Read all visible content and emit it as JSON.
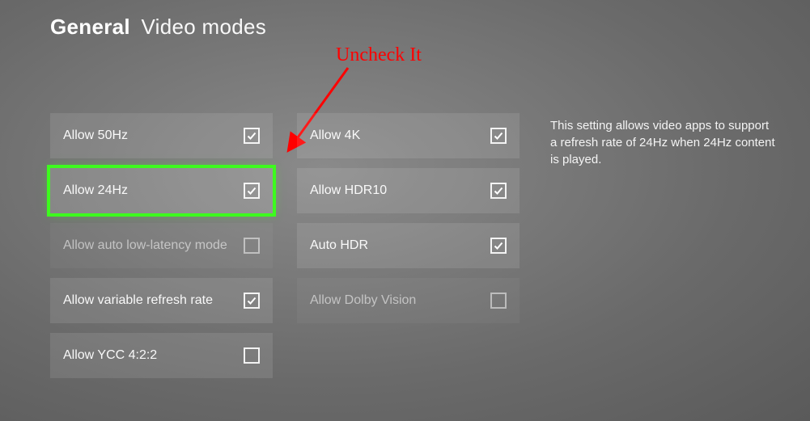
{
  "header": {
    "category": "General",
    "title": "Video modes"
  },
  "left_column": [
    {
      "label": "Allow 50Hz",
      "checked": true,
      "highlighted": false,
      "dim": false
    },
    {
      "label": "Allow 24Hz",
      "checked": true,
      "highlighted": true,
      "dim": false
    },
    {
      "label": "Allow auto low-latency mode",
      "checked": false,
      "highlighted": false,
      "dim": true
    },
    {
      "label": "Allow variable refresh rate",
      "checked": true,
      "highlighted": false,
      "dim": false
    },
    {
      "label": "Allow YCC 4:2:2",
      "checked": false,
      "highlighted": false,
      "dim": false
    }
  ],
  "right_column": [
    {
      "label": "Allow 4K",
      "checked": true,
      "highlighted": false,
      "dim": false
    },
    {
      "label": "Allow HDR10",
      "checked": true,
      "highlighted": false,
      "dim": false
    },
    {
      "label": "Auto HDR",
      "checked": true,
      "highlighted": false,
      "dim": false
    },
    {
      "label": "Allow Dolby Vision",
      "checked": false,
      "highlighted": false,
      "dim": true
    }
  ],
  "description": "This setting allows video apps to support a refresh rate of 24Hz when 24Hz content is played.",
  "annotation": {
    "text": "Uncheck It",
    "arrow_color": "#ff0000"
  }
}
